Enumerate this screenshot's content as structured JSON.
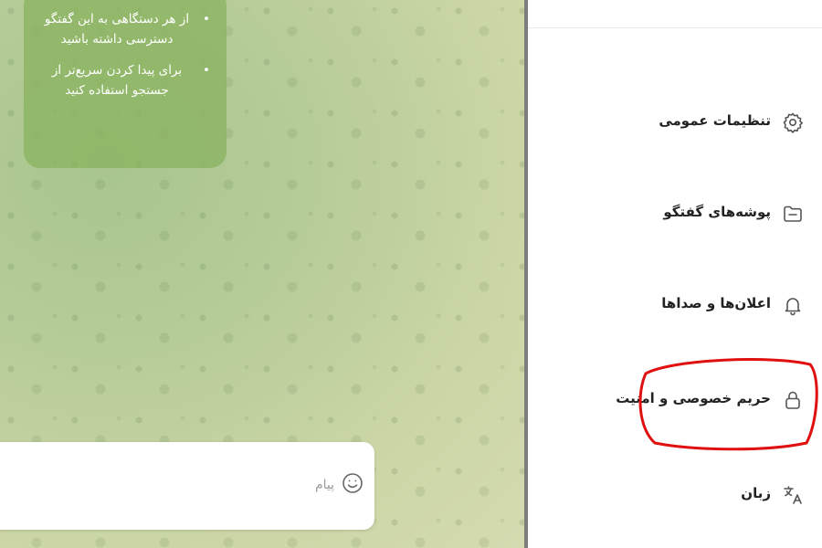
{
  "chat": {
    "info_bullets": [
      "از هر دستگاهی به این گفتگو دسترسی داشته باشید",
      "برای پیدا کردن سریع‌تر از جستجو استفاده کنید"
    ],
    "bullet_symbol": "•",
    "composer": {
      "placeholder": "پیام",
      "emoji_icon": "emoji-icon"
    }
  },
  "settings": {
    "items": [
      {
        "label": "تنظیمات عمومی",
        "icon": "gear-icon"
      },
      {
        "label": "پوشه‌های گفتگو",
        "icon": "folder-icon"
      },
      {
        "label": "اعلان‌ها و صداها",
        "icon": "bell-icon"
      },
      {
        "label": "حریم خصوصی و امنیت",
        "icon": "lock-icon"
      },
      {
        "label": "زبان",
        "icon": "translate-icon"
      }
    ],
    "highlighted_item": "حریم خصوصی و امنیت"
  },
  "colors": {
    "bubble": "#8bb460",
    "annotation": "#e01010",
    "icon": "#555555",
    "divider": "#7d7d7d"
  }
}
